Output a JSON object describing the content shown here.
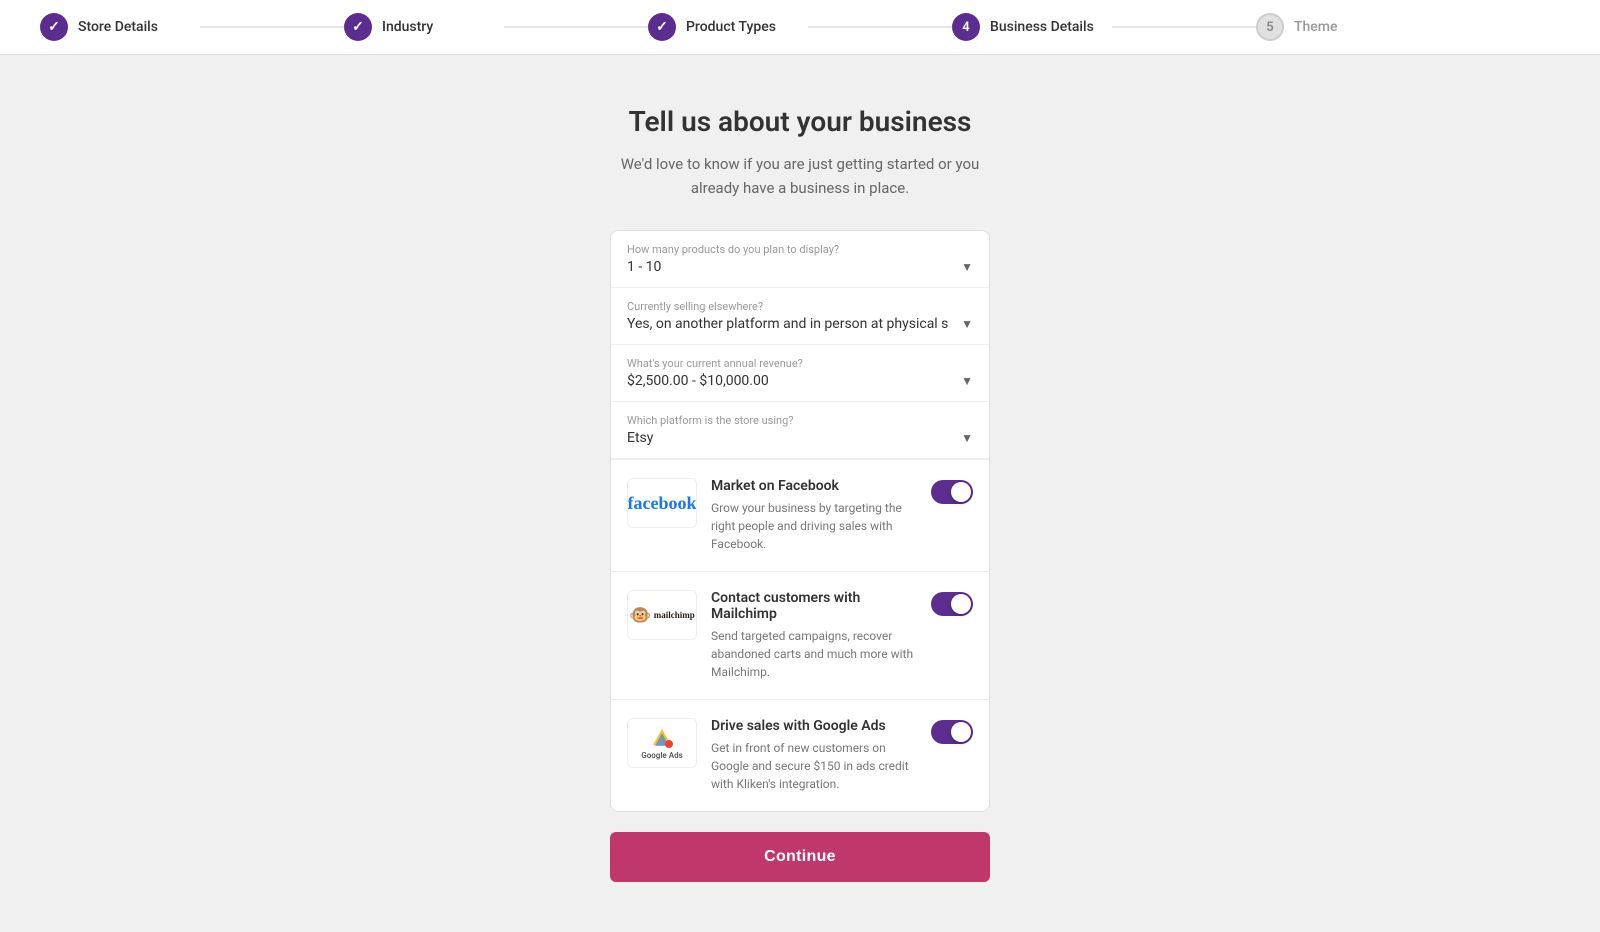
{
  "progress": {
    "steps": [
      {
        "id": "store-details",
        "label": "Store Details",
        "status": "completed",
        "number": "1"
      },
      {
        "id": "industry",
        "label": "Industry",
        "status": "completed",
        "number": "2"
      },
      {
        "id": "product-types",
        "label": "Product Types",
        "status": "completed",
        "number": "3"
      },
      {
        "id": "business-details",
        "label": "Business Details",
        "status": "active",
        "number": "4"
      },
      {
        "id": "theme",
        "label": "Theme",
        "status": "inactive",
        "number": "5"
      }
    ]
  },
  "page": {
    "title": "Tell us about your business",
    "subtitle": "We'd love to know if you are just getting started or you already have a business in place."
  },
  "form": {
    "products_label": "How many products do you plan to display?",
    "products_value": "1 - 10",
    "selling_label": "Currently selling elsewhere?",
    "selling_value": "Yes, on another platform and in person at physical s",
    "revenue_label": "What's your current annual revenue?",
    "revenue_value": "$2,500.00 - $10,000.00",
    "platform_label": "Which platform is the store using?",
    "platform_value": "Etsy"
  },
  "integrations": [
    {
      "id": "facebook",
      "title": "Market on Facebook",
      "description": "Grow your business by targeting the right people and driving sales with Facebook.",
      "logo_type": "facebook",
      "enabled": true
    },
    {
      "id": "mailchimp",
      "title": "Contact customers with Mailchimp",
      "description": "Send targeted campaigns, recover abandoned carts and much more with Mailchimp.",
      "logo_type": "mailchimp",
      "enabled": true
    },
    {
      "id": "google-ads",
      "title": "Drive sales with Google Ads",
      "description": "Get in front of new customers on Google and secure $150 in ads credit with Kliken's integration.",
      "logo_type": "google-ads",
      "enabled": true
    }
  ],
  "continue_button": "Continue",
  "colors": {
    "purple": "#5c2d91",
    "pink": "#c0376c"
  }
}
